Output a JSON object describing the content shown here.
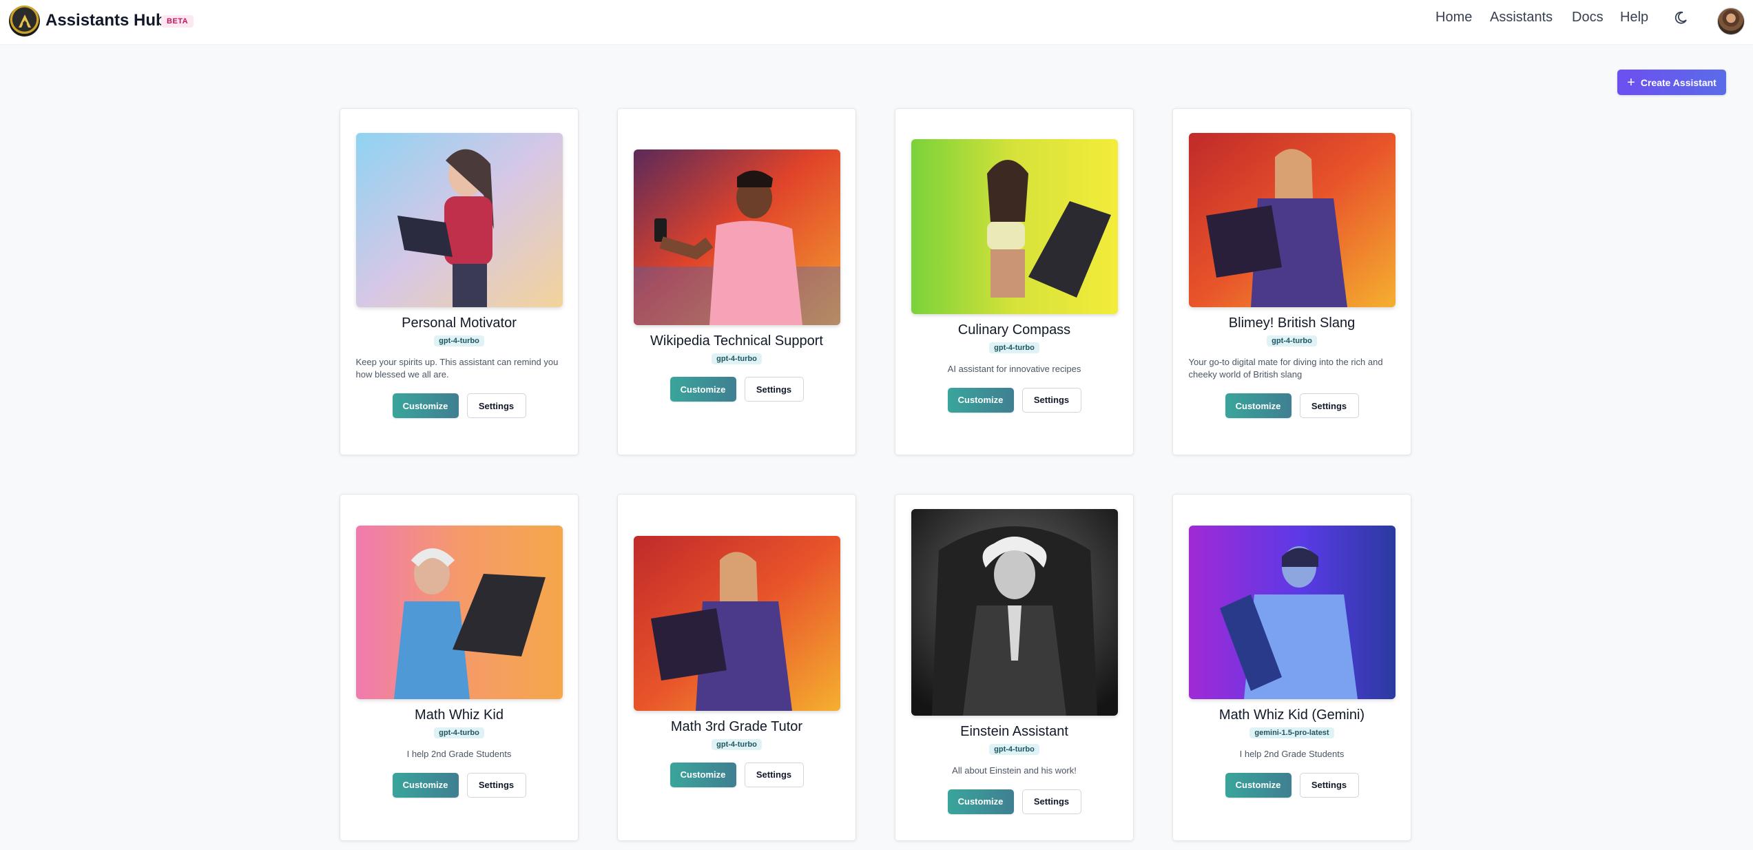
{
  "header": {
    "brand": "Assistants Hub",
    "badge": "BETA",
    "nav": [
      {
        "label": "Home"
      },
      {
        "label": "Assistants"
      },
      {
        "label": "Docs"
      },
      {
        "label": "Help"
      }
    ]
  },
  "actions": {
    "create_label": "Create Assistant"
  },
  "buttons": {
    "customize": "Customize",
    "settings": "Settings"
  },
  "cards": [
    {
      "title": "Personal Motivator",
      "model": "gpt-4-turbo",
      "description": "Keep your spirits up. This assistant can remind you how blessed we all are."
    },
    {
      "title": "Wikipedia Technical Support",
      "model": "gpt-4-turbo",
      "description": ""
    },
    {
      "title": "Culinary Compass",
      "model": "gpt-4-turbo",
      "description": "AI assistant for innovative recipes"
    },
    {
      "title": "Blimey! British Slang",
      "model": "gpt-4-turbo",
      "description": "Your go-to digital mate for diving into the rich and cheeky world of British slang"
    },
    {
      "title": "Math Whiz Kid",
      "model": "gpt-4-turbo",
      "description": "I help 2nd Grade Students"
    },
    {
      "title": "Math 3rd Grade Tutor",
      "model": "gpt-4-turbo",
      "description": ""
    },
    {
      "title": "Einstein Assistant",
      "model": "gpt-4-turbo",
      "description": "All about Einstein and his work!"
    },
    {
      "title": "Math Whiz Kid (Gemini)",
      "model": "gemini-1.5-pro-latest",
      "description": "I help 2nd Grade Students"
    }
  ],
  "colors": {
    "accent": "#5b5ce6",
    "customize": "#3a9596",
    "badge_bg": "#dff3f6"
  }
}
